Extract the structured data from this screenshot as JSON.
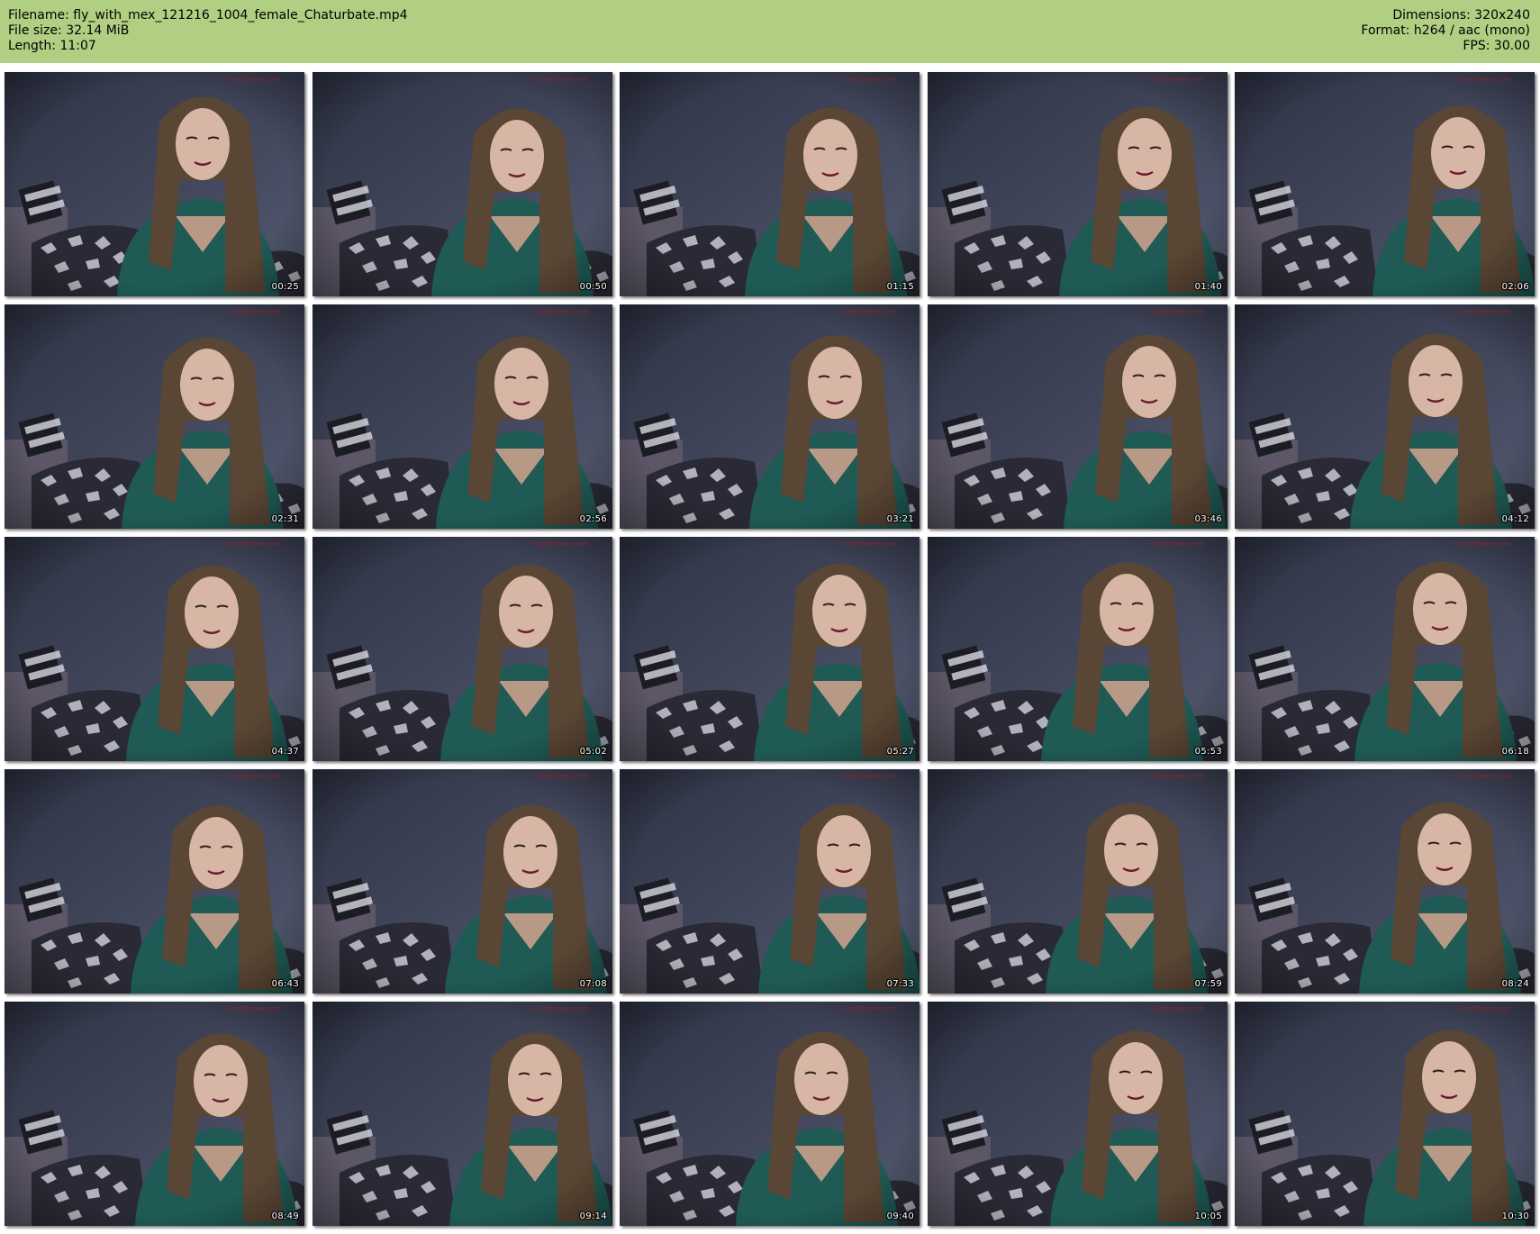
{
  "header": {
    "filename_line": "Filename: fly_with_mex_121216_1004_female_Chaturbate.mp4",
    "filesize_line": "File size: 32.14 MiB",
    "length_line": "Length: 11:07",
    "dimensions_line": "Dimensions: 320x240",
    "format_line": "Format: h264 / aac (mono)",
    "fps_line": "FPS: 30.00"
  },
  "thumbnails": [
    {
      "timestamp": "00:25"
    },
    {
      "timestamp": "00:50"
    },
    {
      "timestamp": "01:15"
    },
    {
      "timestamp": "01:40"
    },
    {
      "timestamp": "02:06"
    },
    {
      "timestamp": "02:31"
    },
    {
      "timestamp": "02:56"
    },
    {
      "timestamp": "03:21"
    },
    {
      "timestamp": "03:46"
    },
    {
      "timestamp": "04:12"
    },
    {
      "timestamp": "04:37"
    },
    {
      "timestamp": "05:02"
    },
    {
      "timestamp": "05:27"
    },
    {
      "timestamp": "05:53"
    },
    {
      "timestamp": "06:18"
    },
    {
      "timestamp": "06:43"
    },
    {
      "timestamp": "07:08"
    },
    {
      "timestamp": "07:33"
    },
    {
      "timestamp": "07:59"
    },
    {
      "timestamp": "08:24"
    },
    {
      "timestamp": "08:49"
    },
    {
      "timestamp": "09:14"
    },
    {
      "timestamp": "09:40"
    },
    {
      "timestamp": "10:05"
    },
    {
      "timestamp": "10:30"
    }
  ],
  "colors": {
    "header_bg": "#b0cf83",
    "wall": "#40455a",
    "sweater": "#1f5a55",
    "hair": "#5a4634",
    "bedding": "#2a2a36"
  }
}
